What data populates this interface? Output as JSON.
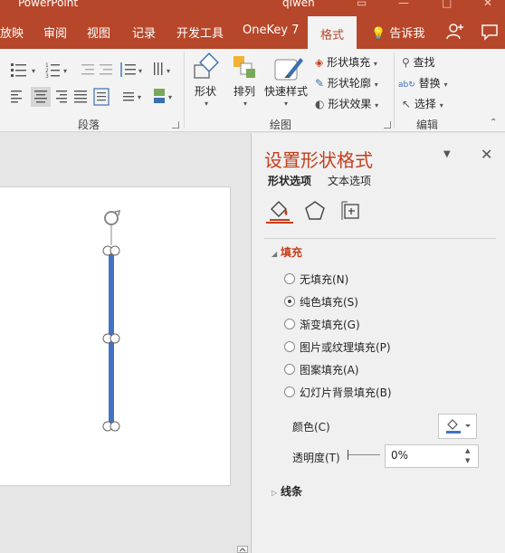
{
  "titlebar": {
    "app_name": "PowerPoint",
    "user": "qiwen"
  },
  "tabs": [
    {
      "label": "放映"
    },
    {
      "label": "审阅"
    },
    {
      "label": "视图"
    },
    {
      "label": "记录"
    },
    {
      "label": "开发工具"
    },
    {
      "label": "OneKey 7"
    },
    {
      "label": "格式"
    }
  ],
  "tell_me": "告诉我",
  "ribbon": {
    "groups": {
      "paragraph": "段落",
      "drawing": "绘图",
      "editing": "编辑"
    },
    "drawing": {
      "shape": "形状",
      "arrange": "排列",
      "quick_styles": "快速样式",
      "shape_fill": "形状填充",
      "shape_outline": "形状轮廓",
      "shape_effects": "形状效果"
    },
    "editing": {
      "find": "查找",
      "replace": "替换",
      "select": "选择"
    }
  },
  "pane": {
    "title": "设置形状格式",
    "tabs": [
      "形状选项",
      "文本选项"
    ],
    "fill_header": "填充",
    "fill_options": [
      {
        "label": "无填充(N)",
        "checked": false
      },
      {
        "label": "纯色填充(S)",
        "checked": true
      },
      {
        "label": "渐变填充(G)",
        "checked": false
      },
      {
        "label": "图片或纹理填充(P)",
        "checked": false
      },
      {
        "label": "图案填充(A)",
        "checked": false
      },
      {
        "label": "幻灯片背景填充(B)",
        "checked": false
      }
    ],
    "color_label": "颜色(C)",
    "opacity_label": "透明度(T)",
    "opacity_value": "0%",
    "line_header": "线条"
  },
  "colors": {
    "accent": "#b7472a",
    "pane_accent": "#c43e1c",
    "shape_line": "#4472c4"
  }
}
